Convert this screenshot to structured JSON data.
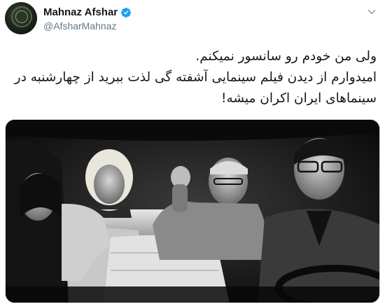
{
  "user": {
    "display_name": "Mahnaz Afshar",
    "handle": "@AfsharMahnaz",
    "verified": true
  },
  "tweet": {
    "lines": [
      "ولی من خودم رو سانسور نمیکنم.",
      "امیدوارم از دیدن فیلم سینمایی آشفته گی لذت ببرید از چهارشنبه در",
      "سینماهای ایران اکران میشه!"
    ]
  },
  "media": {
    "description_icon": "movie-still-image"
  },
  "colors": {
    "verified_blue": "#1da1f2",
    "handle_gray": "#657786",
    "text": "#14171a"
  }
}
